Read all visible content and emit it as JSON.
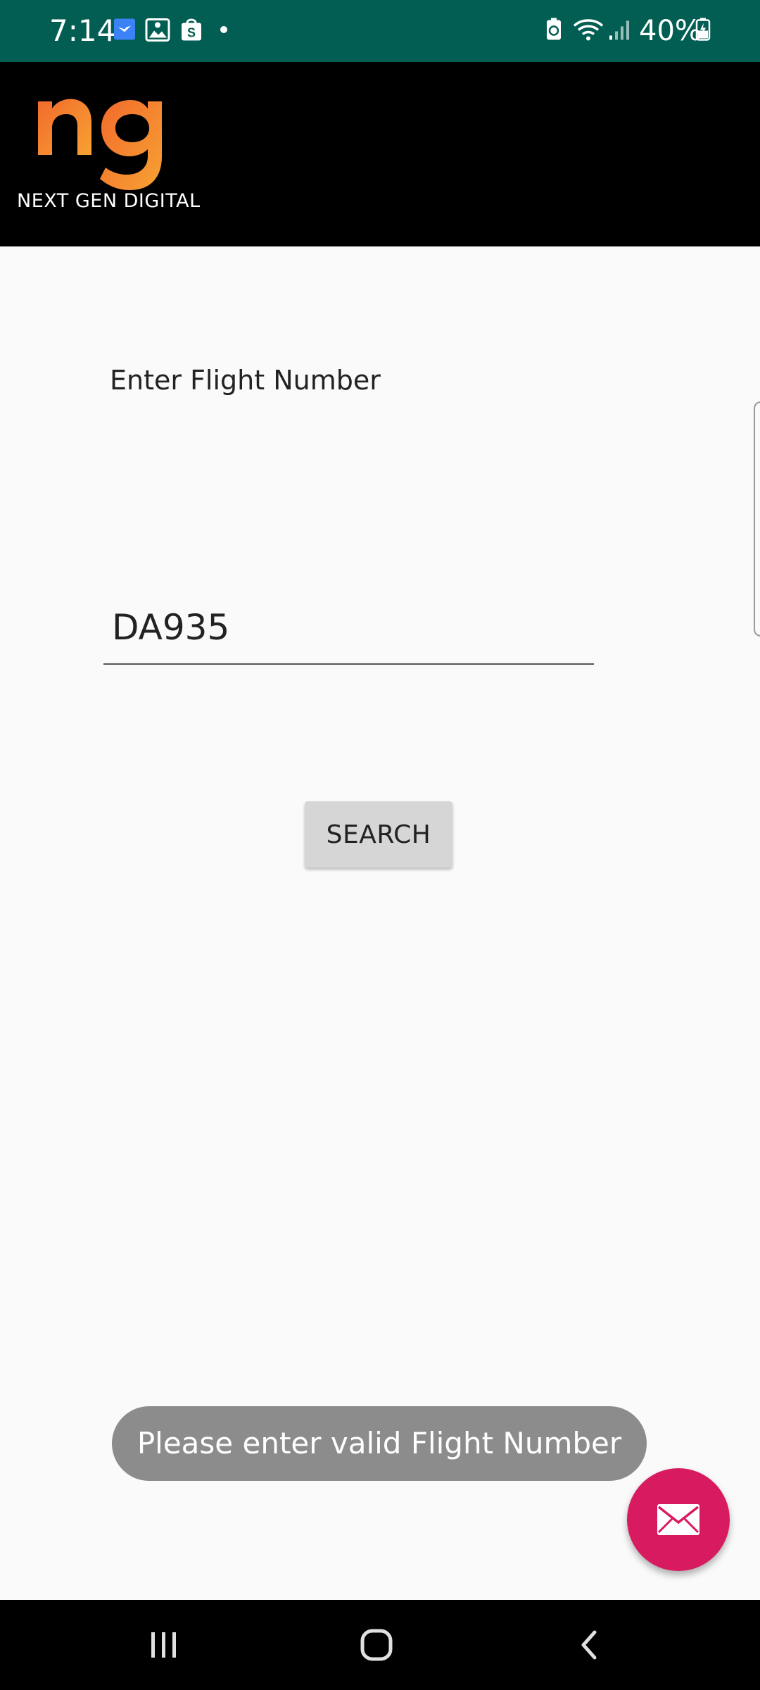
{
  "status_bar": {
    "time": "7:14",
    "battery_percent": "40%",
    "icons": [
      "bird-notification-icon",
      "photo-notification-icon",
      "shopping-bag-icon",
      "dot-icon",
      "battery-saver-icon",
      "wifi-icon",
      "cellular-signal-icon",
      "battery-charging-icon"
    ]
  },
  "header": {
    "logo_mark": "ng",
    "brand_name": "NEXT GEN DIGITAL"
  },
  "form": {
    "label": "Enter Flight Number",
    "input_value": "DA935",
    "search_label": "SEARCH"
  },
  "toast": {
    "message": "Please enter valid Flight Number"
  },
  "fab": {
    "icon": "mail-icon"
  },
  "nav": {
    "icons": [
      "recent-apps-icon",
      "home-icon",
      "back-icon"
    ]
  },
  "colors": {
    "status_bar": "#025e52",
    "app_bar": "#000000",
    "logo_orange": "#f57c2a",
    "fab": "#d81b60",
    "toast": "#8c8c8c",
    "button": "#d6d6d6"
  }
}
